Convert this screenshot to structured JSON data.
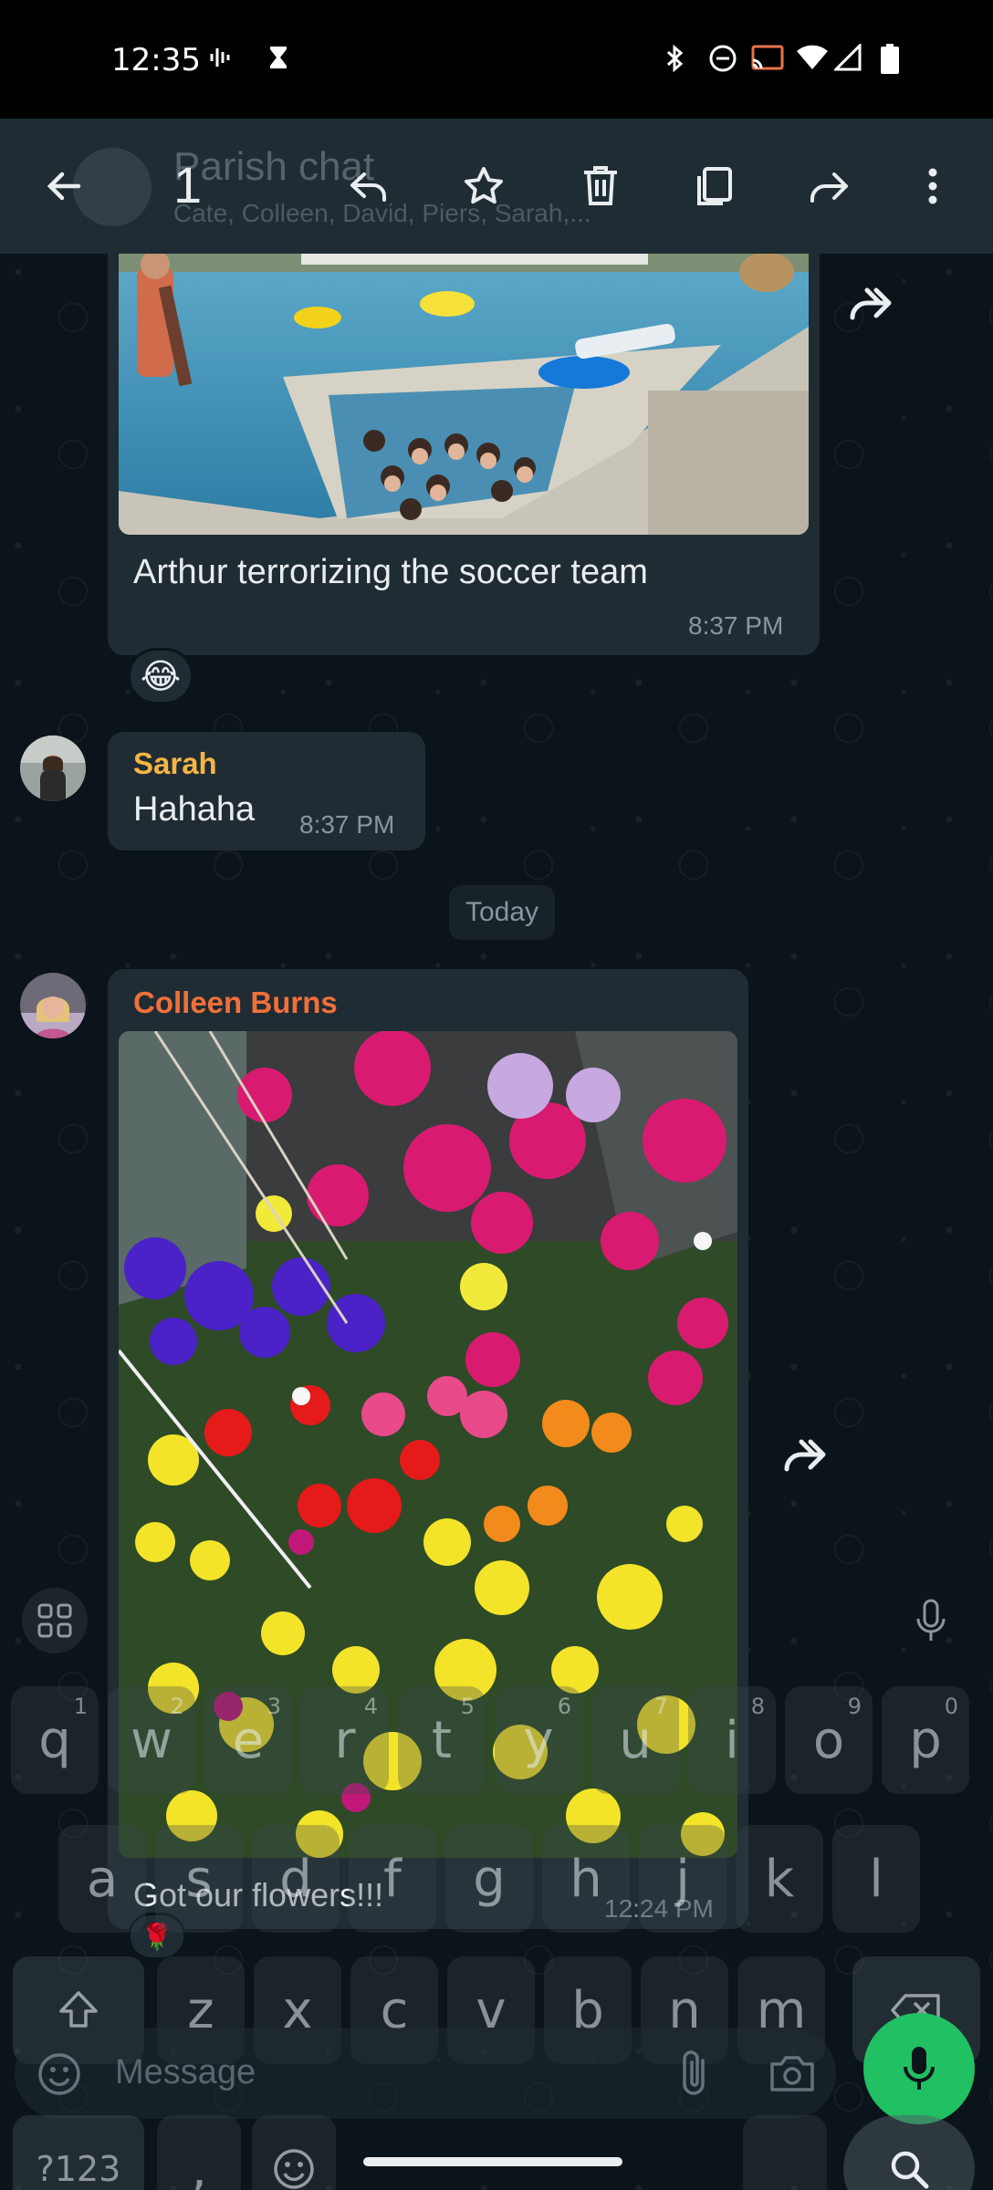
{
  "status_bar": {
    "time": "12:35"
  },
  "top_bar": {
    "chat_title": "Parish chat",
    "chat_members": "Cate, Colleen, David, Piers, Sarah,...",
    "selected_count": "1",
    "actions": [
      "back-icon",
      "reply-icon",
      "star-icon",
      "delete-icon",
      "copy-icon",
      "forward-icon",
      "more-icon"
    ]
  },
  "messages": {
    "pool_photo": {
      "caption": "Arthur terrorizing the soccer team",
      "time": "8:37 PM",
      "reaction": "😂"
    },
    "sarah": {
      "sender": "Sarah",
      "sender_color": "#f5b443",
      "text": "Hahaha",
      "time": "8:37 PM"
    },
    "day_divider": "Today",
    "colleen": {
      "sender": "Colleen Burns",
      "sender_color": "#f1703a",
      "caption": "Got our flowers!!!",
      "time": "12:24 PM",
      "reaction": "🌹"
    }
  },
  "composer": {
    "placeholder": "Message"
  },
  "keyboard": {
    "row1": [
      {
        "key": "q",
        "num": "1"
      },
      {
        "key": "w",
        "num": "2"
      },
      {
        "key": "e",
        "num": "3"
      },
      {
        "key": "r",
        "num": "4"
      },
      {
        "key": "t",
        "num": "5"
      },
      {
        "key": "y",
        "num": "6"
      },
      {
        "key": "u",
        "num": "7"
      },
      {
        "key": "i",
        "num": "8"
      },
      {
        "key": "o",
        "num": "9"
      },
      {
        "key": "p",
        "num": "0"
      }
    ],
    "row2": [
      "a",
      "s",
      "d",
      "f",
      "g",
      "h",
      "j",
      "k",
      "l"
    ],
    "row3": [
      "z",
      "x",
      "c",
      "v",
      "b",
      "n",
      "m"
    ],
    "symbols_label": "?123",
    "comma_label": ","
  },
  "colors": {
    "background": "#0b141a",
    "bubble": "#202c33",
    "header": "#1f2c33",
    "accent_green": "#21c063"
  }
}
